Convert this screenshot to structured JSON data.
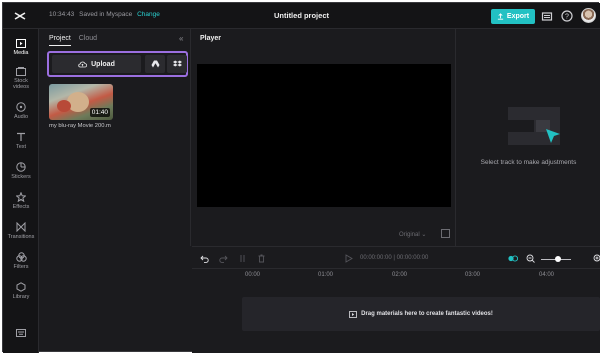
{
  "header": {
    "time": "10:34:43",
    "saved_text": "Saved in Myspace",
    "change_label": "Change",
    "project_title": "Untitled project",
    "export_label": "Export"
  },
  "rail": {
    "items": [
      {
        "label": "Media"
      },
      {
        "label": "Stock videos"
      },
      {
        "label": "Audio"
      },
      {
        "label": "Text"
      },
      {
        "label": "Stickers"
      },
      {
        "label": "Effects"
      },
      {
        "label": "Transitions"
      },
      {
        "label": "Filters"
      },
      {
        "label": "Library"
      }
    ]
  },
  "media": {
    "tabs": [
      {
        "label": "Project"
      },
      {
        "label": "Cloud"
      }
    ],
    "upload_label": "Upload",
    "file": {
      "name": "my blu-ray Movie 200.m",
      "duration": "01:40"
    }
  },
  "player": {
    "title": "Player",
    "ratio_label": "Original"
  },
  "props": {
    "message": "Select track to make adjustments"
  },
  "timeline": {
    "timecode": "00:00:00:00 | 00:00:00:00",
    "ticks": [
      "00:00",
      "01:00",
      "02:00",
      "03:00",
      "04:00"
    ],
    "drop_hint": "Drag materials here to create fantastic videos!"
  },
  "colors": {
    "accent": "#22c1c3",
    "highlight_border": "#9b6fe0",
    "background": "#1b1b1e"
  }
}
